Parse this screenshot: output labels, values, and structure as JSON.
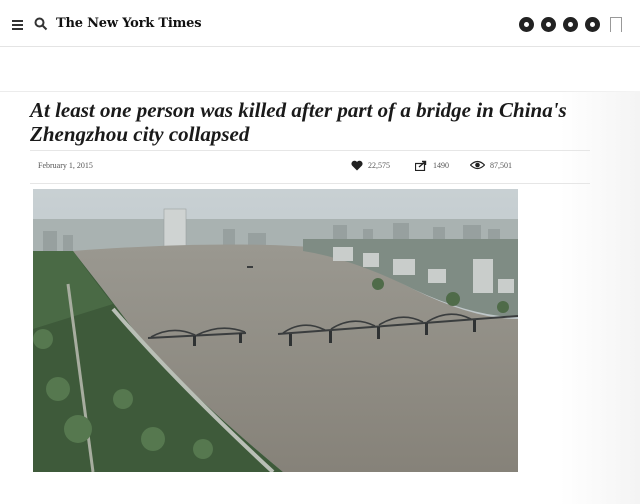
{
  "header": {
    "logo": "The New York Times",
    "icons": [
      "menu-icon",
      "search-icon",
      "facebook-icon",
      "twitter-icon",
      "email-icon",
      "share-icon",
      "bookmark-icon"
    ]
  },
  "article": {
    "headline": "At least one person was killed after part of a bridge in China's Zhengzhou city collapsed",
    "date": "February 1, 2015",
    "likes": "22,575",
    "shares": "1490",
    "views": "87,501",
    "image_description": "Aerial view of a wide river with a multi-span steel bridge, partially collapsed in the middle, and a city skyline"
  },
  "colors": {
    "text": "#111111",
    "river": "#8f8f88",
    "sky": "#c7cfd2",
    "trees": "#3e5a3a"
  }
}
